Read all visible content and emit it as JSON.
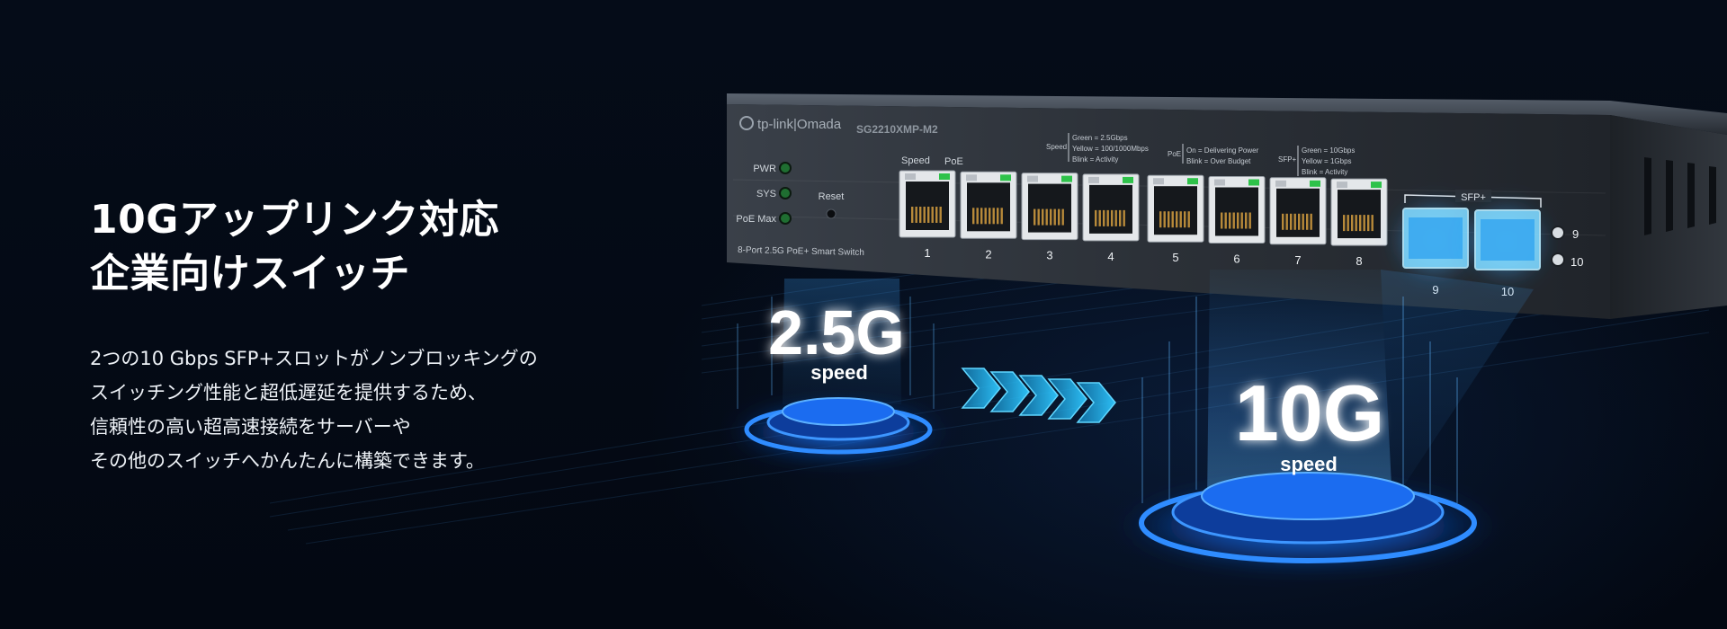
{
  "headline": {
    "line1": "10Gアップリンク対応",
    "line2": "企業向けスイッチ"
  },
  "description": {
    "line1": "2つの10 Gbps SFP+スロットがノンブロッキングの",
    "line2": "スイッチング性能と超低遅延を提供するため、",
    "line3": "信頼性の高い超高速接続をサーバーや",
    "line4": "その他のスイッチへかんたんに構築できます。"
  },
  "device": {
    "brand": "tp-link|Omada",
    "model": "SG2210XMP-M2",
    "subtitle": "8-Port 2.5G PoE+ Smart Switch",
    "led_pwr": "PWR",
    "led_sys": "SYS",
    "led_poe": "PoE Max",
    "reset": "Reset",
    "col_speed": "Speed",
    "col_poe": "PoE",
    "legend_speed_key": "Speed",
    "legend_speed_1": "Green = 2.5Gbps",
    "legend_speed_2": "Yellow = 100/1000Mbps",
    "legend_speed_3": "Blink = Activity",
    "legend_poe_key": "PoE",
    "legend_poe_1": "On = Delivering Power",
    "legend_poe_2": "Blink = Over Budget",
    "legend_sfp_key": "SFP+",
    "legend_sfp_1": "Green = 10Gbps",
    "legend_sfp_2": "Yellow = 1Gbps",
    "legend_sfp_3": "Blink = Activity",
    "sfp_group_label": "SFP+",
    "ports": [
      "1",
      "2",
      "3",
      "4",
      "5",
      "6",
      "7",
      "8"
    ],
    "sfp_ports": [
      "9",
      "10"
    ],
    "sfp_led_labels": [
      "9",
      "10"
    ]
  },
  "badges": {
    "left_value": "2.5G",
    "left_unit": "speed",
    "right_value": "10G",
    "right_unit": "speed"
  },
  "colors": {
    "background": "#040b16",
    "accent_blue": "#2f8cff",
    "glow_cyan": "#27b8ff",
    "led_green": "#2ec24a",
    "chassis": "#2a2f36"
  }
}
